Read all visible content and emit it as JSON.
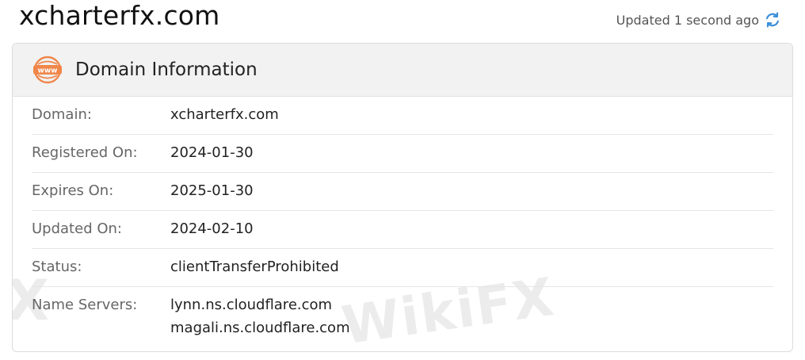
{
  "header": {
    "site_title": "xcharterfx.com",
    "updated_text": "Updated 1 second ago"
  },
  "card": {
    "title": "Domain Information",
    "icon_text": "www",
    "rows": [
      {
        "label": "Domain:",
        "values": [
          "xcharterfx.com"
        ]
      },
      {
        "label": "Registered On:",
        "values": [
          "2024-01-30"
        ]
      },
      {
        "label": "Expires On:",
        "values": [
          "2025-01-30"
        ]
      },
      {
        "label": "Updated On:",
        "values": [
          "2024-02-10"
        ]
      },
      {
        "label": "Status:",
        "values": [
          "clientTransferProhibited"
        ]
      },
      {
        "label": "Name Servers:",
        "values": [
          "lynn.ns.cloudflare.com",
          "magali.ns.cloudflare.com"
        ]
      }
    ]
  },
  "watermark": {
    "text": "WikiFX",
    "partial": "X"
  },
  "colors": {
    "accent_orange": "#f0874a",
    "refresh_blue": "#3b8fd9"
  },
  "icons": {
    "refresh": "refresh-icon",
    "www": "www-icon"
  }
}
